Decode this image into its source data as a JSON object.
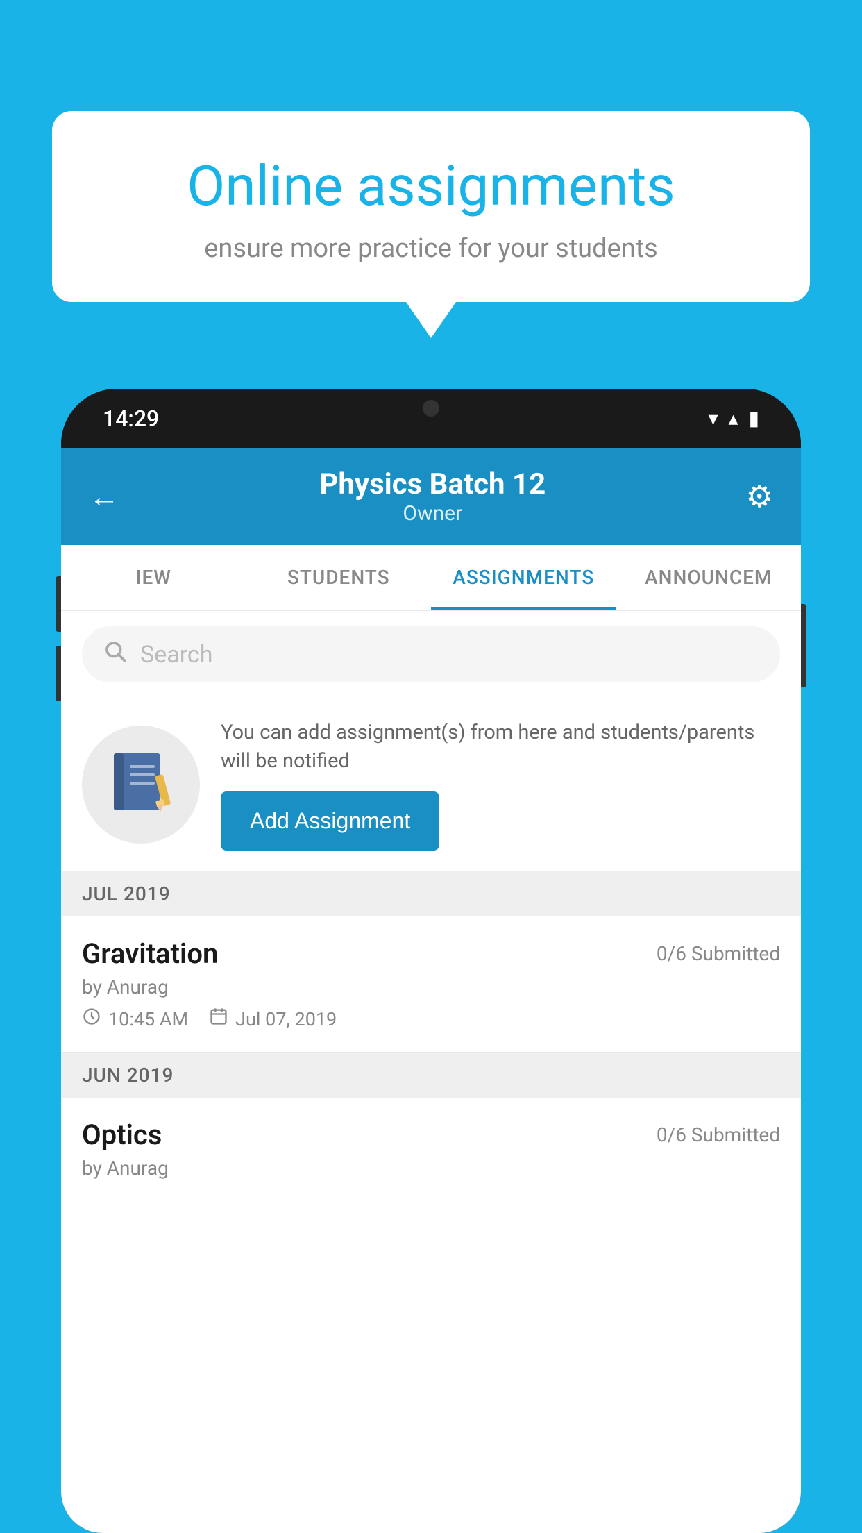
{
  "background": {
    "color": "#1ab3e8"
  },
  "speech_bubble": {
    "title": "Online assignments",
    "subtitle": "ensure more practice for your students"
  },
  "phone": {
    "status_bar": {
      "time": "14:29",
      "wifi_icon": "▼",
      "signal_icon": "▲",
      "battery_icon": "▮"
    },
    "app_header": {
      "back_label": "←",
      "title": "Physics Batch 12",
      "subtitle": "Owner",
      "settings_icon": "⚙"
    },
    "tabs": [
      {
        "label": "IEW",
        "active": false
      },
      {
        "label": "STUDENTS",
        "active": false
      },
      {
        "label": "ASSIGNMENTS",
        "active": true
      },
      {
        "label": "ANNOUNCEM",
        "active": false
      }
    ],
    "search": {
      "placeholder": "Search"
    },
    "promo": {
      "description": "You can add assignment(s) from here and students/parents will be notified",
      "button_label": "Add Assignment"
    },
    "sections": [
      {
        "header": "JUL 2019",
        "assignments": [
          {
            "name": "Gravitation",
            "submitted": "0/6 Submitted",
            "author": "by Anurag",
            "time": "10:45 AM",
            "date": "Jul 07, 2019"
          }
        ]
      },
      {
        "header": "JUN 2019",
        "assignments": [
          {
            "name": "Optics",
            "submitted": "0/6 Submitted",
            "author": "by Anurag",
            "time": "",
            "date": ""
          }
        ]
      }
    ]
  }
}
